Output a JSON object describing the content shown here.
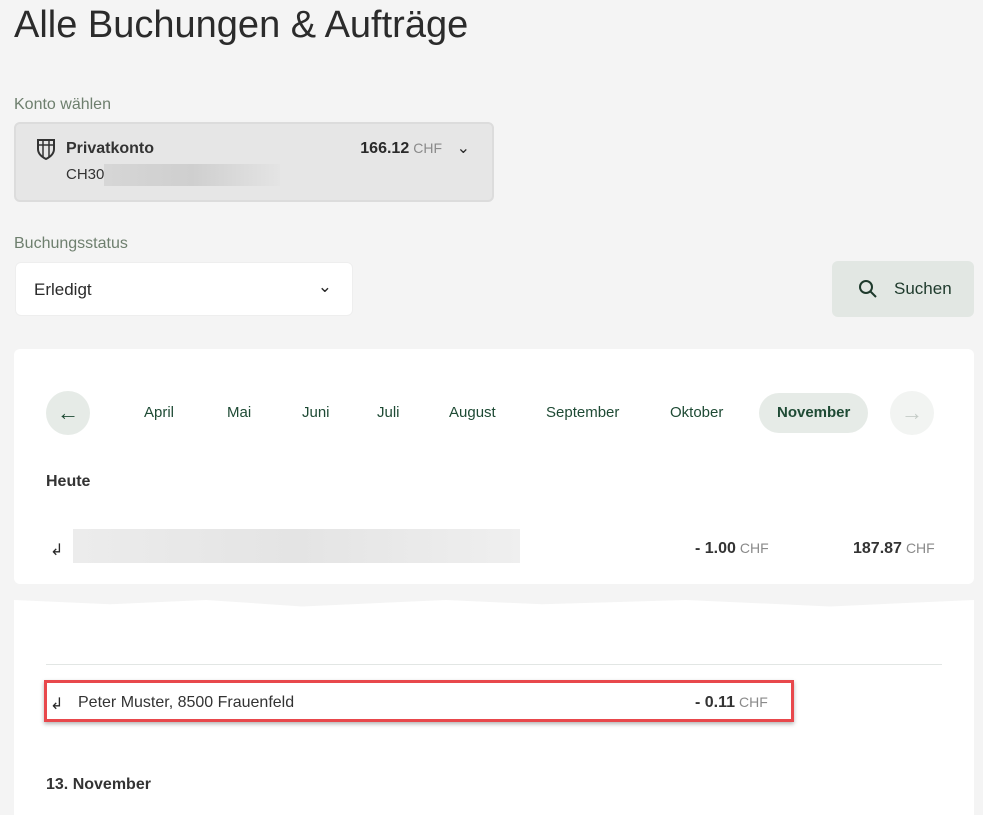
{
  "page": {
    "title": "Alle Buchungen & Aufträge"
  },
  "account": {
    "label": "Konto wählen",
    "name": "Privatkonto",
    "iban_prefix": "CH30",
    "balance": "166.12",
    "currency": "CHF",
    "icon": "shield-icon"
  },
  "status": {
    "label": "Buchungsstatus",
    "value": "Erledigt"
  },
  "search": {
    "label": "Suchen"
  },
  "months": [
    "April",
    "Mai",
    "Juni",
    "Juli",
    "August",
    "September",
    "Oktober",
    "November"
  ],
  "active_month": "November",
  "sections": [
    {
      "title": "Heute",
      "rows": [
        {
          "amount": "- 1.00",
          "currency": "CHF",
          "balance": "187.87",
          "balance_currency": "CHF"
        }
      ]
    },
    {
      "rows": [
        {
          "name": "Peter Muster, 8500 Frauenfeld",
          "amount": "- 0.11",
          "currency": "CHF"
        }
      ]
    },
    {
      "title": "13. November"
    }
  ]
}
